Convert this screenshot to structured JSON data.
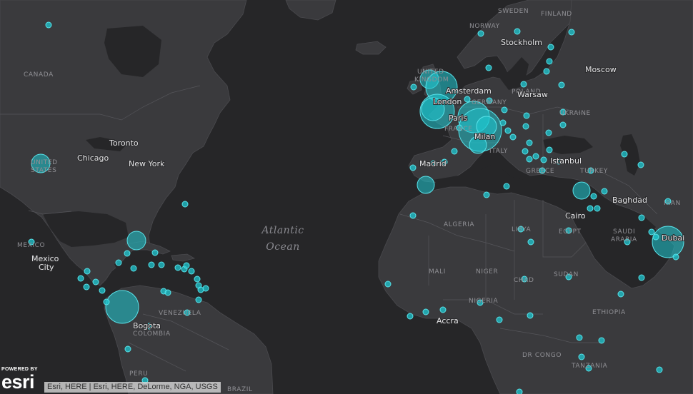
{
  "map": {
    "ocean_label_line1": "Atlantic",
    "ocean_label_line2": "Ocean",
    "country_labels": [
      "SWEDEN",
      "FINLAND",
      "NORWAY",
      "CANADA",
      "UNITED",
      "KINGDOM",
      "GERMANY",
      "POLAND",
      "UKRAINE",
      "FRANCE",
      "ITALY",
      "GREECE",
      "TURKEY",
      "UNITED",
      "STATES",
      "MEXICO",
      "ALGERIA",
      "LIBYA",
      "EGYPT",
      "SAUDI",
      "ARABIA",
      "IRAN",
      "MALI",
      "NIGER",
      "CHAD",
      "SUDAN",
      "NIGERIA",
      "ETHIOPIA",
      "DR CONGO",
      "TANZANIA",
      "VENEZUELA",
      "COLOMBIA",
      "PERU",
      "BRAZIL"
    ],
    "city_labels": [
      "Stockholm",
      "Moscow",
      "Amsterdam",
      "Warsaw",
      "London",
      "Paris",
      "Milan",
      "Madrid",
      "Istanbul",
      "Baghdad",
      "Cairo",
      "Dubai",
      "Toronto",
      "Chicago",
      "New York",
      "Mexico",
      "City",
      "Bogota",
      "Accra"
    ],
    "marker_color": "#1ec8d2",
    "land_color": "#3a3a3d",
    "water_color": "#262628"
  },
  "branding": {
    "powered_by": "POWERED BY",
    "logo": "esri"
  },
  "attribution": {
    "text": "Esri, HERE | Esri, HERE, DeLorme, NGA, USGS"
  }
}
